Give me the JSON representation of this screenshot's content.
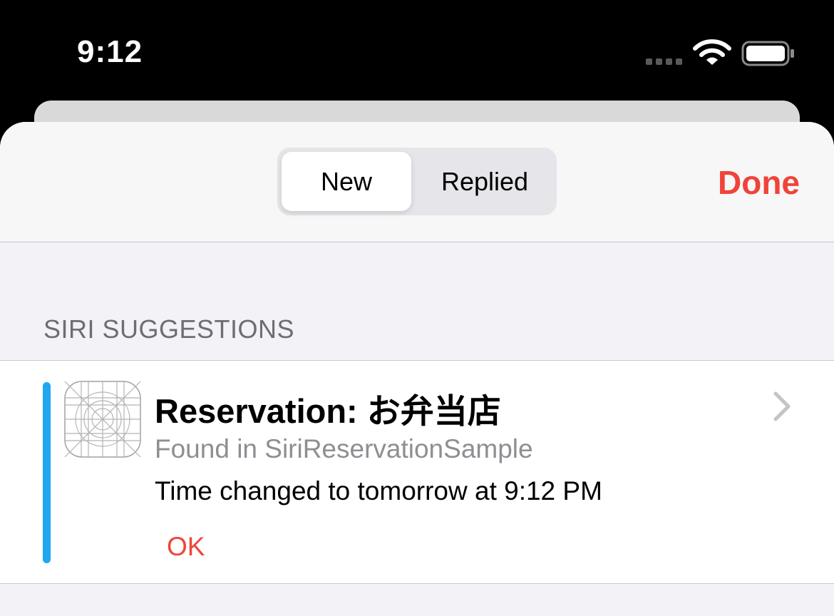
{
  "status_bar": {
    "time": "9:12",
    "signal_icon": "cellular-signal-icon",
    "wifi_icon": "wifi-icon",
    "battery_icon": "battery-icon"
  },
  "nav": {
    "segments": [
      {
        "label": "New",
        "selected": true
      },
      {
        "label": "Replied",
        "selected": false
      }
    ],
    "done_label": "Done"
  },
  "section": {
    "header": "SIRI SUGGESTIONS"
  },
  "suggestion": {
    "title": "Reservation: お弁当店",
    "subtitle": "Found in SiriReservationSample",
    "detail": "Time changed to tomorrow at 9:12 PM",
    "action_label": "OK",
    "app_icon": "app-icon-placeholder",
    "chevron_icon": "chevron-right-icon"
  },
  "colors": {
    "accent": "#f0433a",
    "indicator": "#1fa7f0",
    "secondary_text": "#8e8e93",
    "background": "#f2f2f7"
  }
}
